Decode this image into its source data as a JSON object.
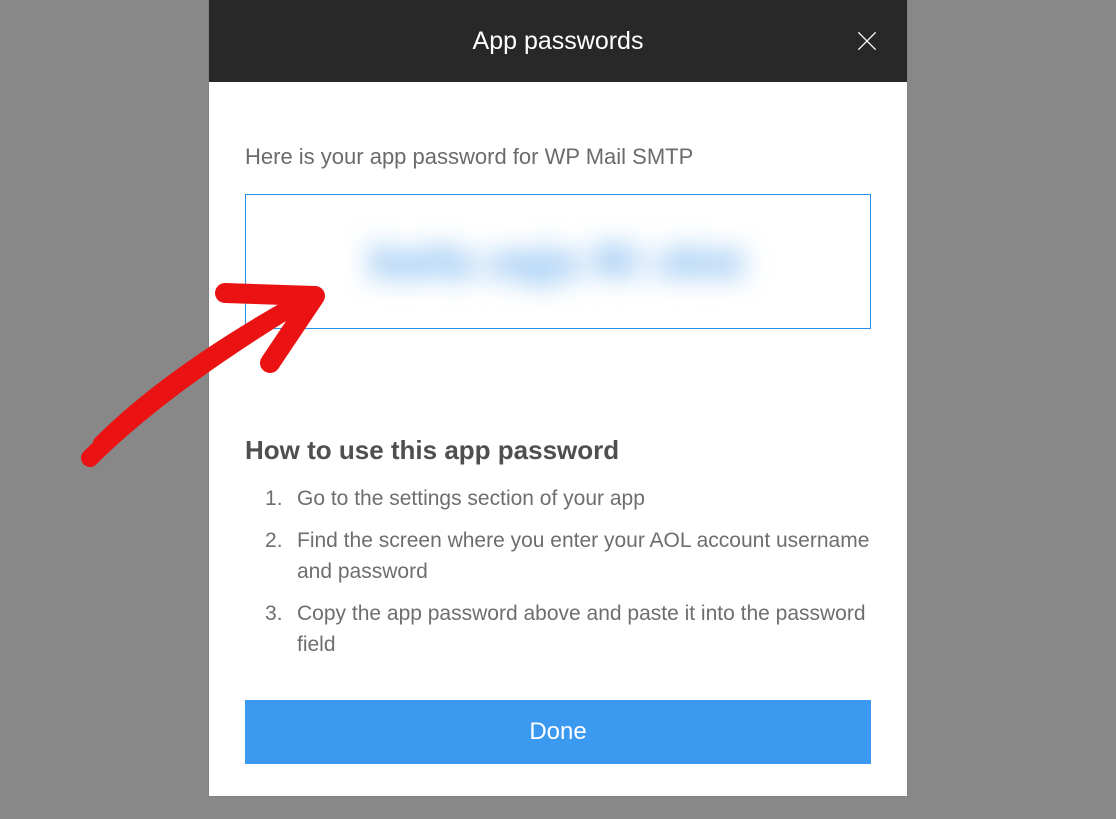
{
  "header": {
    "title": "App passwords"
  },
  "intro": "Here is your app password for WP Mail SMTP",
  "password_display": "bwfa oqjs Ri vkm",
  "instructions": {
    "title": "How to use this app password",
    "steps": [
      "Go to the settings section of your app",
      "Find the screen where you enter your AOL account username and password",
      "Copy the app password above and paste it into the password field"
    ]
  },
  "done_label": "Done"
}
